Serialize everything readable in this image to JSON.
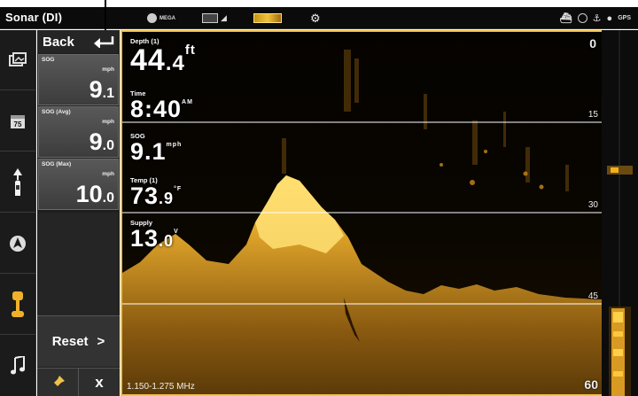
{
  "topbar": {
    "title": "Sonar (DI)",
    "mega_label": "MEGA",
    "icons": [
      "mega-imaging-icon",
      "screen-view-icon",
      "chart-sonar-icon",
      "gear-search-icon",
      "boat-icon",
      "steering-icon",
      "anchor-icon",
      "compass-icon",
      "gps-icon"
    ]
  },
  "sidebar": {
    "icons": [
      "image-gallery-icon",
      "calendar-icon",
      "boat-navigation-icon",
      "waypoint-icon",
      "trolling-motor-icon",
      "music-icon"
    ],
    "calendar_day": "75"
  },
  "panel": {
    "back_label": "Back",
    "tiles": [
      {
        "label": "SOG",
        "unit": "mph",
        "whole": "9",
        "decimal": ".1"
      },
      {
        "label": "SOG (Avg)",
        "unit": "mph",
        "whole": "9",
        "decimal": ".0"
      },
      {
        "label": "SOG (Max)",
        "unit": "mph",
        "whole": "10",
        "decimal": ".0"
      }
    ],
    "reset_label": "Reset",
    "reset_arrow": ">",
    "pin_label": "pin",
    "close_label": "x"
  },
  "readouts": {
    "depth": {
      "label": "Depth (1)",
      "whole": "44",
      "decimal": ".4",
      "unit": "ft"
    },
    "time": {
      "label": "Time",
      "value": "8:40",
      "suffix": "AM"
    },
    "sog": {
      "label": "SOG",
      "value": "9.1",
      "unit": "mph"
    },
    "temp": {
      "label": "Temp (1)",
      "whole": "73",
      "decimal": ".9",
      "unit": "°F"
    },
    "supply": {
      "label": "Supply",
      "whole": "13",
      "decimal": ".0",
      "unit": "V"
    }
  },
  "scale": {
    "ticks": [
      "0",
      "15",
      "30",
      "45",
      "60"
    ],
    "frequency": "1.150-1.275 MHz"
  },
  "colors": {
    "accent": "#f0c04a",
    "sonar_bright": "#ffd14a",
    "sonar_mid": "#b07a18",
    "sonar_dark": "#3a2606",
    "panel": "#1e1e1e",
    "tile": "#4a4a4a"
  }
}
